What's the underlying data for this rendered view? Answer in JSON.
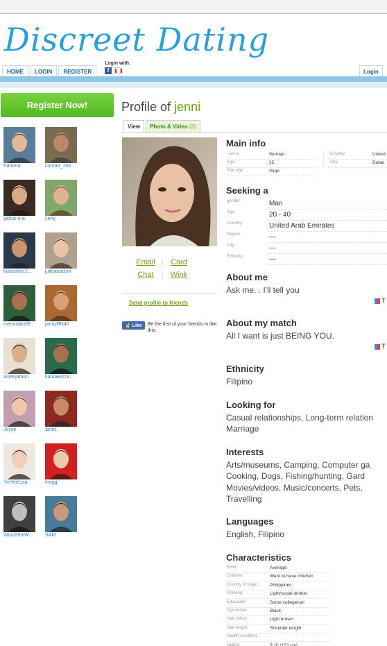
{
  "site": {
    "logo": "Discreet Dating"
  },
  "nav": {
    "items": [
      "HOME",
      "LOGIN",
      "REGISTER"
    ],
    "login_with": "Login with:",
    "login_right": "Login"
  },
  "sidebar": {
    "register": "Register Now!",
    "members": [
      {
        "name": "Pantera"
      },
      {
        "name": "conrad_765"
      },
      {
        "name": "yanus-y-a"
      },
      {
        "name": "Leny"
      },
      {
        "name": "luiscarlos.2..."
      },
      {
        "name": "julieatuazon"
      },
      {
        "name": "memoabo39"
      },
      {
        "name": "pinayRN40"
      },
      {
        "name": "aurelijamon"
      },
      {
        "name": "kamalesh.k..."
      },
      {
        "name": "Joyce"
      },
      {
        "name": "aztec"
      },
      {
        "name": "YinYeeLisa"
      },
      {
        "name": "megg"
      },
      {
        "name": "Word2theW..."
      },
      {
        "name": "SAM"
      }
    ]
  },
  "profile": {
    "title_prefix": "Profile of ",
    "username": "jenni",
    "tabs": {
      "view": "View",
      "photo": "Photo & Video",
      "photo_count": "(3)"
    },
    "actions": {
      "email": "Email",
      "card": "Card",
      "chat": "Chat",
      "wink": "Wink",
      "sep": "|"
    },
    "send_profile": "Send profile to friends",
    "fb_like": "Like",
    "fb_text": "Be the first of your friends to like this."
  },
  "main_info": {
    "heading": "Main info",
    "left": [
      {
        "label": "I am a:",
        "value": "Woman"
      },
      {
        "label": "Age:",
        "value": "25"
      },
      {
        "label": "Star sign:",
        "value": "Virgo"
      }
    ],
    "right": [
      {
        "label": "Country:",
        "value": "United"
      },
      {
        "label": "City:",
        "value": "Dubai"
      }
    ]
  },
  "seeking": {
    "heading": "Seeking a",
    "rows": [
      {
        "label": "gender:",
        "value": "Man"
      },
      {
        "label": "Age:",
        "value": "20 - 40"
      },
      {
        "label": "Country:",
        "value": "United Arab Emirates"
      },
      {
        "label": "Region:",
        "value": "—"
      },
      {
        "label": "City:",
        "value": "—"
      },
      {
        "label": "Ethnicity:",
        "value": "—"
      }
    ]
  },
  "about_me": {
    "heading": "About me",
    "text": "Ask me. . I'll tell you",
    "translate": "T"
  },
  "about_match": {
    "heading": "About my match",
    "text": "All I want is just BEING YOU.",
    "translate": "T"
  },
  "ethnicity": {
    "heading": "Ethnicity",
    "text": "Filipino"
  },
  "looking_for": {
    "heading": "Looking for",
    "line1": "Casual relationships,  Long-term relation",
    "line2": " Marriage"
  },
  "interests": {
    "heading": "Interests",
    "line1": "Arts/museums,  Camping,  Computer ga",
    "line2": " Cooking,  Dogs,  Fishing/hunting,  Gard",
    "line3": " Movies/videos,  Music/concerts,  Pets,",
    "line4": " Travelling"
  },
  "languages": {
    "heading": "Languages",
    "text": "English,  Filipino"
  },
  "characteristics": {
    "heading": "Characteristics",
    "rows": [
      {
        "label": "Build:",
        "value": "Average"
      },
      {
        "label": "Children:",
        "value": "Want to have children"
      },
      {
        "label": "Country of origin:",
        "value": "Philippines"
      },
      {
        "label": "Drinking:",
        "value": "Light/social drinker"
      },
      {
        "label": "Education:",
        "value": "Some college/uni"
      },
      {
        "label": "Eye colour:",
        "value": "Black"
      },
      {
        "label": "Hair colour:",
        "value": "Light brown"
      },
      {
        "label": "Hair length:",
        "value": "Shoulder length"
      },
      {
        "label": "Health condition:",
        "value": ""
      },
      {
        "label": "Height:",
        "value": "5' 0\" (152 cm)"
      }
    ]
  }
}
